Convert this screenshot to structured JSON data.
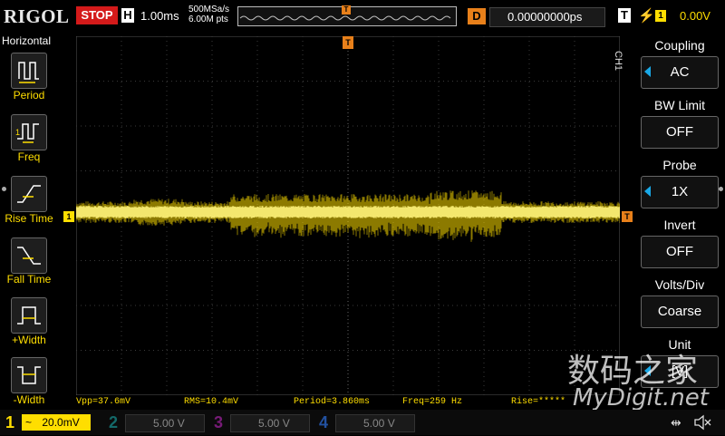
{
  "header": {
    "logo": "RIGOL",
    "run_state": "STOP",
    "timebase_badge": "H",
    "timebase": "1.00ms",
    "sample_rate": "500MSa/s",
    "memory_depth": "6.00M pts",
    "delay_badge": "D",
    "delay": "0.00000000ps",
    "trigger_badge": "T",
    "trigger_source": "1",
    "trigger_level": "0.00V",
    "trigger_pos_marker": "T"
  },
  "left_menu": {
    "title": "Horizontal",
    "items": [
      {
        "label": "Period",
        "icon": "period-icon"
      },
      {
        "label": "Freq",
        "icon": "freq-icon"
      },
      {
        "label": "Rise Time",
        "icon": "rise-time-icon"
      },
      {
        "label": "Fall Time",
        "icon": "fall-time-icon"
      },
      {
        "label": "+Width",
        "icon": "pos-width-icon"
      },
      {
        "label": "-Width",
        "icon": "neg-width-icon"
      }
    ]
  },
  "right_panel": {
    "channel_tag": "CH1",
    "items": [
      {
        "head": "Coupling",
        "value": "AC",
        "has_arrow": true
      },
      {
        "head": "BW Limit",
        "value": "OFF",
        "has_arrow": false
      },
      {
        "head": "Probe",
        "value": "1X",
        "has_arrow": true
      },
      {
        "head": "Invert",
        "value": "OFF",
        "has_arrow": false
      },
      {
        "head": "Volts/Div",
        "value": "Coarse",
        "has_arrow": false
      },
      {
        "head": "Unit",
        "value": "[V]",
        "has_arrow": true
      }
    ]
  },
  "markers": {
    "ch1_left": "1",
    "trigger_right": "T"
  },
  "measurements": {
    "vpp": "Vpp=37.6mV",
    "rms": "RMS=10.4mV",
    "period": "Period=3.860ms",
    "freq": "Freq=259 Hz",
    "rise": "Rise=*****"
  },
  "channels": [
    {
      "num": "1",
      "coupling_glyph": "~",
      "scale": "20.0mV",
      "color": "#ffde00",
      "active": true
    },
    {
      "num": "2",
      "coupling_glyph": "",
      "scale": "5.00 V",
      "color": "#19a8a8",
      "active": false
    },
    {
      "num": "3",
      "coupling_glyph": "",
      "scale": "5.00 V",
      "color": "#c026c0",
      "active": false
    },
    {
      "num": "4",
      "coupling_glyph": "",
      "scale": "5.00 V",
      "color": "#2d6fe0",
      "active": false
    }
  ],
  "watermark": {
    "cn": "数码之家",
    "en": "MyDigit.net"
  },
  "colors": {
    "ch1": "#ffde00",
    "trigger": "#e8801a",
    "stop": "#d41a1a",
    "menu_arrow": "#19a8e6"
  }
}
